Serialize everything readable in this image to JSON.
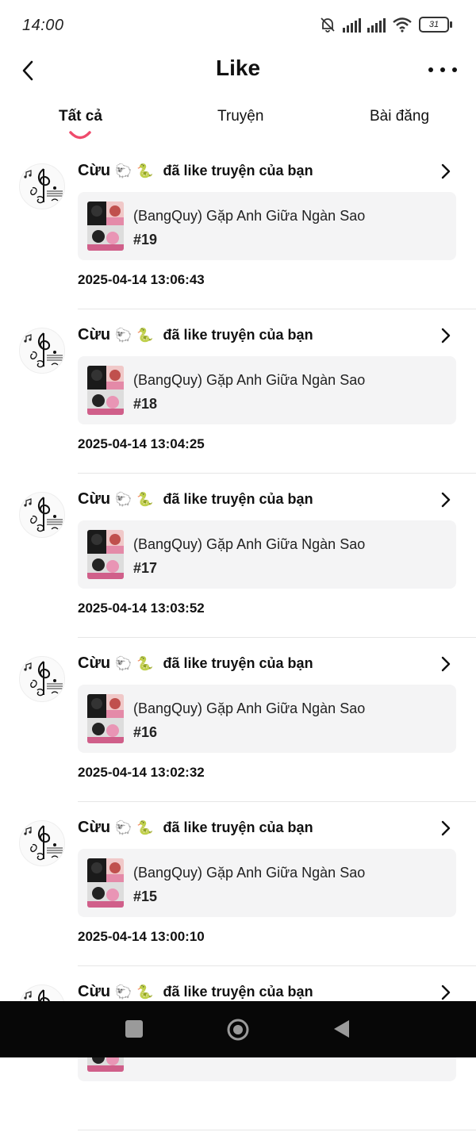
{
  "status_bar": {
    "time": "14:00",
    "battery": "31",
    "icons": [
      "mute-bell-icon",
      "signal-icon",
      "signal-icon",
      "wifi-icon",
      "battery-icon"
    ]
  },
  "header": {
    "title": "Like",
    "back_icon": "back-arrow-icon",
    "more_icon": "more-dots-icon"
  },
  "tabs": [
    {
      "label": "Tất cả",
      "active": true
    },
    {
      "label": "Truyện",
      "active": false
    },
    {
      "label": "Bài đăng",
      "active": false
    }
  ],
  "colors": {
    "accent": "#ef4b6c",
    "card_bg": "#f4f4f5",
    "nav_bg": "#070707"
  },
  "items": [
    {
      "user": "Cừu",
      "emoji1": "🐑",
      "emoji2": "🐍",
      "action": "đã like truyện của bạn",
      "story": "(BangQuy) Gặp Anh Giữa Ngàn Sao",
      "chapter": "#19",
      "time": "2025-04-14 13:06:43"
    },
    {
      "user": "Cừu",
      "emoji1": "🐑",
      "emoji2": "🐍",
      "action": "đã like truyện của bạn",
      "story": "(BangQuy) Gặp Anh Giữa Ngàn Sao",
      "chapter": "#18",
      "time": "2025-04-14 13:04:25"
    },
    {
      "user": "Cừu",
      "emoji1": "🐑",
      "emoji2": "🐍",
      "action": "đã like truyện của bạn",
      "story": "(BangQuy) Gặp Anh Giữa Ngàn Sao",
      "chapter": "#17",
      "time": "2025-04-14 13:03:52"
    },
    {
      "user": "Cừu",
      "emoji1": "🐑",
      "emoji2": "🐍",
      "action": "đã like truyện của bạn",
      "story": "(BangQuy) Gặp Anh Giữa Ngàn Sao",
      "chapter": "#16",
      "time": "2025-04-14 13:02:32"
    },
    {
      "user": "Cừu",
      "emoji1": "🐑",
      "emoji2": "🐍",
      "action": "đã like truyện của bạn",
      "story": "(BangQuy) Gặp Anh Giữa Ngàn Sao",
      "chapter": "#15",
      "time": "2025-04-14 13:00:10"
    },
    {
      "user": "Cừu",
      "emoji1": "🐑",
      "emoji2": "🐍",
      "action": "đã like truyện của bạn",
      "story": "",
      "chapter": "",
      "time": ""
    }
  ],
  "nav": [
    "recents-square-icon",
    "home-circle-icon",
    "back-triangle-icon"
  ]
}
